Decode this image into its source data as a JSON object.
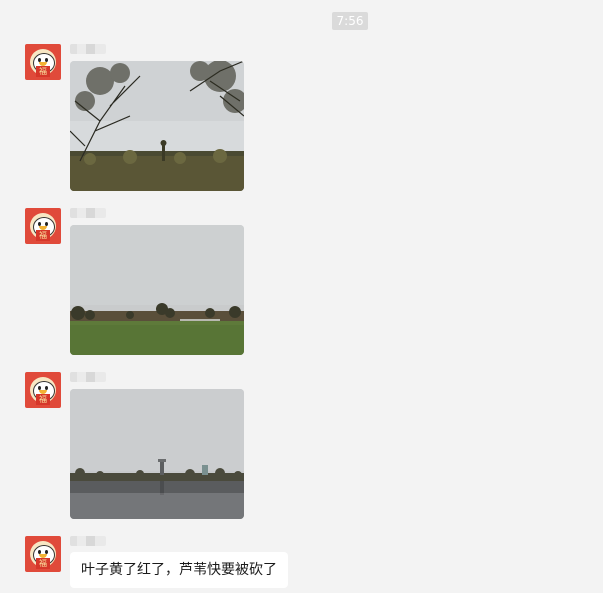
{
  "chat": {
    "timestamp": "7:56",
    "messages": [
      {
        "type": "image",
        "scene": "trees and reeds under overcast sky"
      },
      {
        "type": "image",
        "scene": "green lawn with distant treeline"
      },
      {
        "type": "image",
        "scene": "lake with tower reflection"
      },
      {
        "type": "text",
        "text": "叶子黄了红了，芦苇快要被砍了"
      }
    ]
  },
  "colors": {
    "background": "#f3f3f3",
    "bubble": "#ffffff",
    "timestamp_bg": "#dadada"
  },
  "icons": {
    "avatar": "penguin-fu-avatar-icon"
  }
}
